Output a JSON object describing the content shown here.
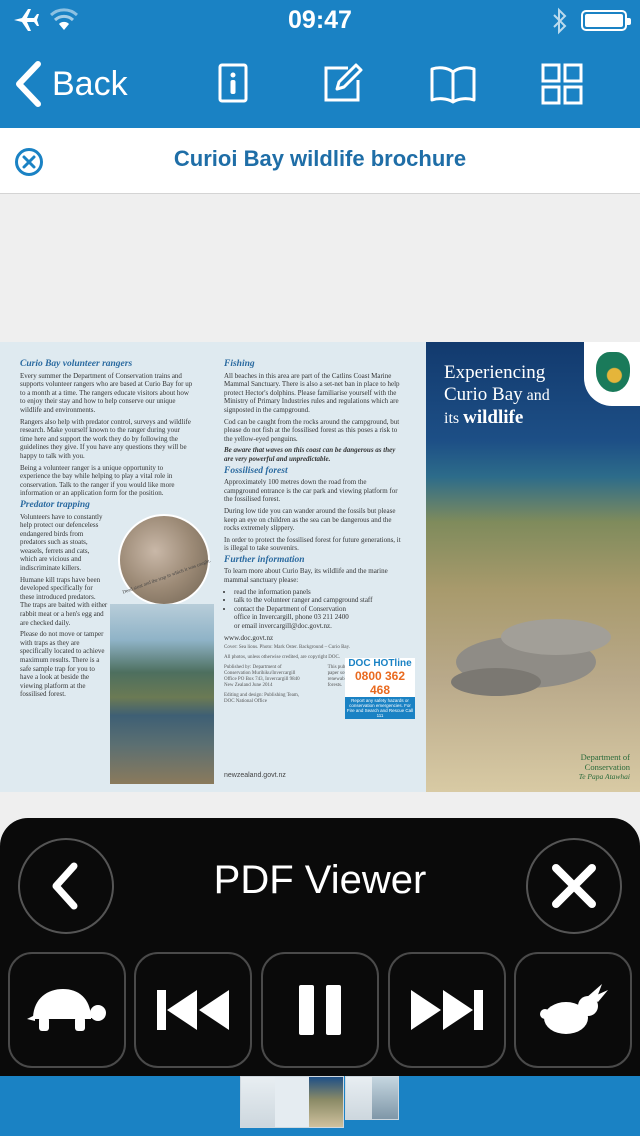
{
  "status_bar": {
    "time": "09:47"
  },
  "nav": {
    "back_label": "Back",
    "icons": [
      "info-page-icon",
      "edit-icon",
      "book-icon",
      "grid-icon"
    ]
  },
  "document": {
    "title": "Curioi Bay wildlife brochure"
  },
  "brochure": {
    "col1": {
      "h1": "Curio Bay volunteer rangers",
      "p1": "Every summer the Department of Conservation trains and supports volunteer rangers who are based at Curio Bay for up to a month at a time. The rangers educate visitors about how to enjoy their stay and how to help conserve our unique wildlife and environments.",
      "p2": "Rangers also help with predator control, surveys and wildlife research. Make yourself known to the ranger during your time here and support the work they do by following the guidelines they give. If you have any questions they will be happy to talk with you.",
      "p3": "Being a volunteer ranger is a unique opportunity to experience the bay while helping to play a vital role in conservation. Talk to the ranger if you would like more information or an application form for the position.",
      "h2": "Predator trapping",
      "p4": "Volunteers have to constantly help protect our defenceless endangered birds from predators such as stoats, weasels, ferrets and cats, which are vicious and indiscriminate killers.",
      "p5": "Humane kill traps have been developed specifically for these introduced predators. The traps are baited with either rabbit meat or a hen's egg and are checked daily.",
      "p6": "Please do not move or tamper with traps as they are specifically located to achieve maximum results. There is a safe sample trap for you to have a look at beside the viewing platform at the fossilised forest.",
      "caption": "Dead stoat and the trap in which it was caught."
    },
    "col2": {
      "h1": "Fishing",
      "p1": "All beaches in this area are part of the Catlins Coast Marine Mammal Sanctuary. There is also a set-net ban in place to help protect Hector's dolphins. Please familiarise yourself with the Ministry of Primary Industries rules and regulations which are signposted in the campground.",
      "p2": "Cod can be caught from the rocks around the campground, but please do not fish at the fossilised forest as this poses a risk to the yellow-eyed penguins.",
      "p3": "Be aware that waves on this coast can be dangerous as they are very powerful and unpredictable.",
      "h2": "Fossilised forest",
      "p4": "Approximately 100 metres down the road from the campground entrance is the car park and viewing platform for the fossilised forest.",
      "p5": "During low tide you can wander around the fossils but please keep an eye on children as the sea can be dangerous and the rocks extremely slippery.",
      "p6": "In order to protect the fossilised forest for future generations, it is illegal to take souvenirs.",
      "h3": "Further information",
      "p7": "To learn more about Curio Bay, its wildlife and the marine mammal sanctuary please:",
      "li1": "read the information panels",
      "li2": "talk to the volunteer ranger and campground staff",
      "li3": "contact the Department of Conservation office in Invercargill, phone 03 211 2400 or email invercargill@doc.govt.nz.",
      "web": "www.doc.govt.nz",
      "cover_credit": "Cover: Sea lions. Photo: Mark Oster. Background – Curio Bay.",
      "photo_credit": "All photos, unless otherwise credited, are copyright DOC.",
      "published": "Published by: Department of Conservation Murihiku/Invercargill Office PO Box 743, Invercargill 9840 New Zealand June 2014",
      "editing": "Editing and design: Publishing Team, DOC National Office",
      "paper": "This publication is produced using paper sourced from well-managed, renewable and legally logged forests.",
      "nzgov": "newzealand.govt.nz"
    },
    "hotline": {
      "label": "DOC HOTline",
      "number": "0800 362 468",
      "note": "Report any safety hazards or conservation emergencies. For Fire and Search and Rescue Call 111"
    },
    "cover": {
      "line1": "Experiencing",
      "line2a": "Curio Bay",
      "line2b": " and",
      "line3a": "its ",
      "line3b": "wildlife",
      "dept1": "Department of",
      "dept2": "Conservation",
      "maori": "Te Papa Atawhai"
    }
  },
  "viewer": {
    "title": "PDF Viewer",
    "controls": [
      "slow-tortoise-icon",
      "skip-back-icon",
      "pause-icon",
      "skip-forward-icon",
      "fast-hare-icon"
    ]
  },
  "colors": {
    "primary_blue": "#1a82c4",
    "title_blue": "#1f6ea7",
    "viewer_bg": "#0a0a0a"
  }
}
